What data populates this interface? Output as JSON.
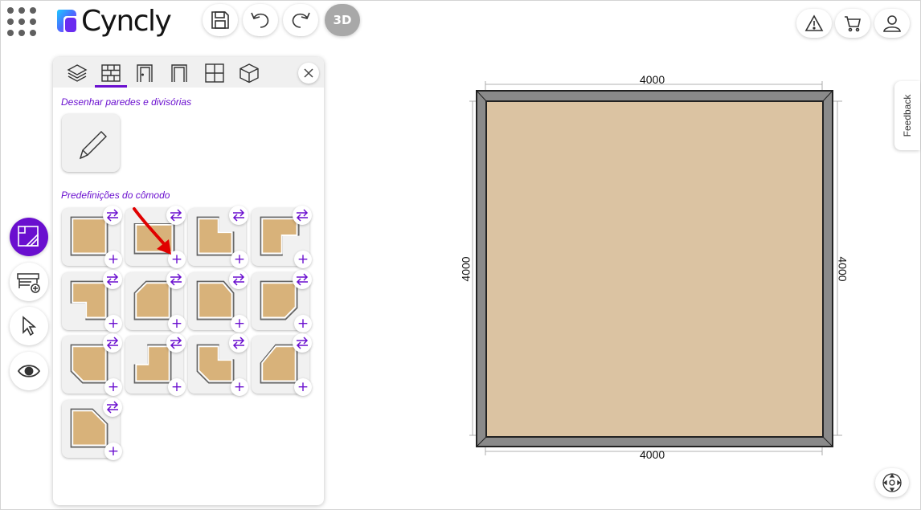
{
  "app": {
    "logo_text": "Cyncly"
  },
  "toolbar": {
    "view_3d_label": "3D"
  },
  "colors": {
    "accent": "#6a0fcf",
    "floor": "#dbc3a2",
    "wall": "#8a8a8a",
    "annotation_arrow": "#e00000"
  },
  "panel": {
    "tabs": [
      "layers-icon",
      "walls-icon",
      "door-icon",
      "opening-icon",
      "window-icon",
      "object-3d-icon"
    ],
    "active_tab": "walls-icon",
    "draw_section_title": "Desenhar paredes e divisórias",
    "presets_section_title": "Predefinições do cômodo",
    "preset_add_label": "+",
    "presets": [
      "rectangle",
      "rectangle-wide",
      "notch-top-right",
      "notch-top-right-large",
      "notch-bottom-left",
      "chamfer-top-left",
      "chamfer-top-right",
      "chamfer-bottom-right",
      "chamfer-bottom-left",
      "step-top-left",
      "chamfer-bottom-left-notch",
      "step-top-left-chamfer",
      "chamfer-top-right-large"
    ]
  },
  "canvas": {
    "width_top": "4000",
    "width_bottom": "4000",
    "height_left": "4000",
    "height_right": "4000"
  },
  "feedback_label": "Feedback"
}
